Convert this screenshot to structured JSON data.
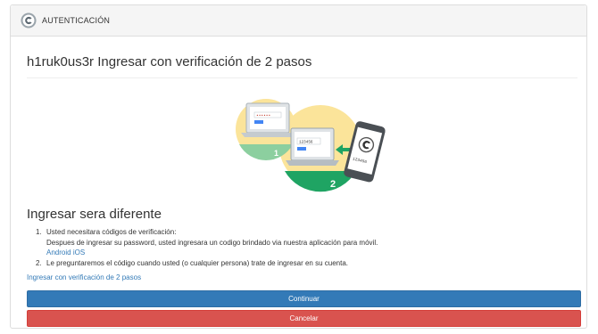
{
  "panel": {
    "heading": "AUTENTICACIÓN"
  },
  "main": {
    "title": "h1ruk0us3r Ingresar con verificación de 2 pasos",
    "illustration": {
      "screen_code_1": "••••••",
      "phone_code": "123456",
      "laptop_code": "123456",
      "step_1": "1",
      "step_2": "2"
    },
    "subtitle": "Ingresar sera diferente",
    "steps": [
      {
        "number": "1.",
        "line1": "Usted necesitara códigos de verificación:",
        "line2": "Despues de ingresar su password, usted ingresara un codigo brindado via nuestra aplicación para móvil.",
        "links": [
          "Android",
          "iOS"
        ]
      },
      {
        "number": "2.",
        "line1": "Le preguntaremos el código cuando usted (o cualquier persona) trate de ingresar en su cuenta."
      }
    ],
    "enable_link": "Ingresar con verificación de 2 pasos",
    "continue_button": "Continuar",
    "cancel_button": "Cancelar"
  },
  "colors": {
    "primary": "#337ab7",
    "danger": "#d9534f",
    "illustration_yellow": "#fbe49a",
    "illustration_green": "#1fa463",
    "illustration_blue": "#4285f4"
  },
  "icons": [
    "shield-logo-icon",
    "arrow-left-icon"
  ]
}
